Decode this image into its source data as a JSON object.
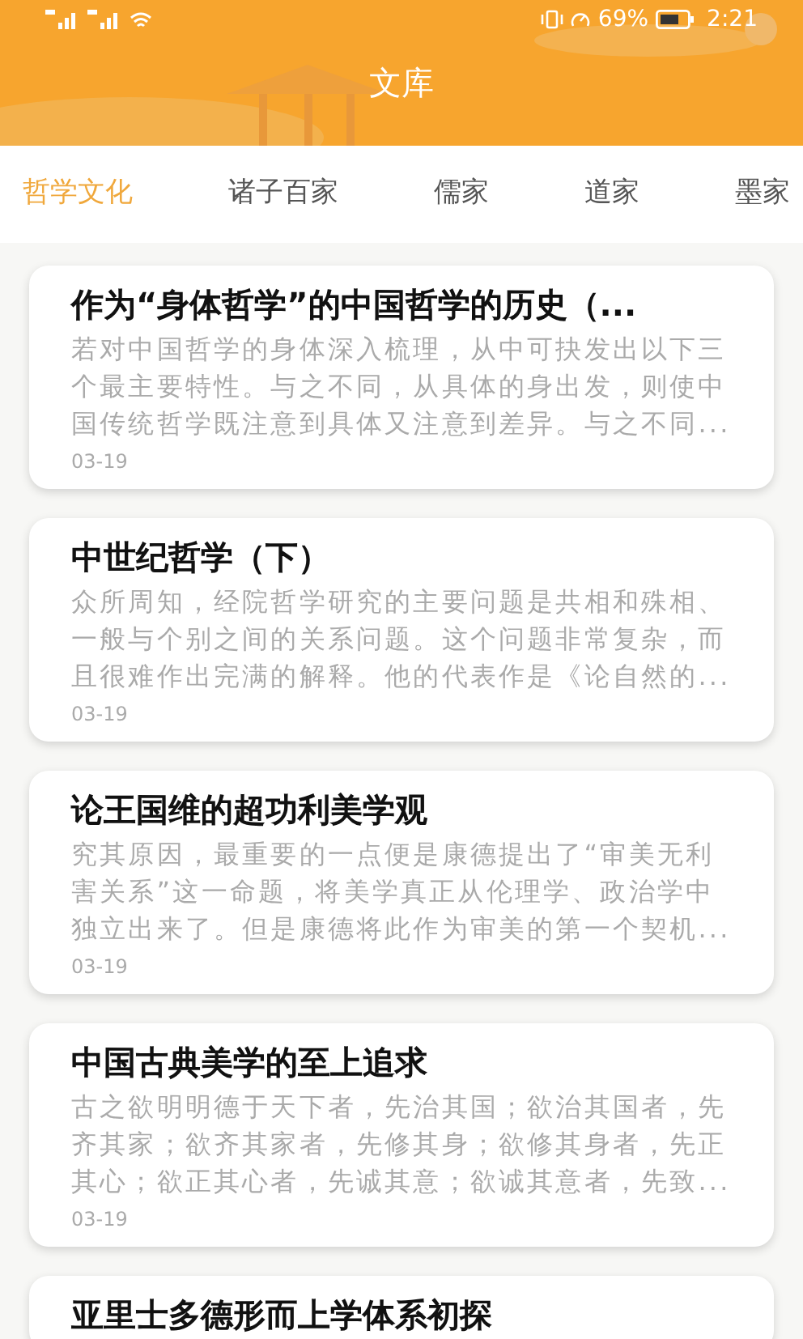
{
  "status_bar": {
    "battery": "69%",
    "time": "2:21"
  },
  "header": {
    "title": "文库"
  },
  "tabs": [
    {
      "label": "哲学文化",
      "selected": true
    },
    {
      "label": "诸子百家",
      "selected": false
    },
    {
      "label": "儒家",
      "selected": false
    },
    {
      "label": "道家",
      "selected": false
    },
    {
      "label": "墨家",
      "selected": false
    }
  ],
  "articles": [
    {
      "title": "作为“身体哲学”的中国哲学的历史（...",
      "summary": "若对中国哲学的身体深入梳理，从中可抉发出以下三个最主要特性。与之不同，从具体的身出发，则使中国传统哲学既注意到具体又注意到差异。与之不同...",
      "date": "03-19"
    },
    {
      "title": "中世纪哲学（下）",
      "summary": "众所周知，经院哲学研究的主要问题是共相和殊相、一般与个别之间的关系问题。这个问题非常复杂，而且很难作出完满的解释。他的代表作是《论自然的...",
      "date": "03-19"
    },
    {
      "title": "论王国维的超功利美学观",
      "summary": "究其原因，最重要的一点便是康德提出了“审美无利害关系”这一命题，将美学真正从伦理学、政治学中独立出来了。但是康德将此作为审美的第一个契机...",
      "date": "03-19"
    },
    {
      "title": "中国古典美学的至上追求",
      "summary": "古之欲明明德于天下者，先治其国；欲治其国者，先齐其家；欲齐其家者，先修其身；欲修其身者，先正其心；欲正其心者，先诚其意；欲诚其意者，先致...",
      "date": "03-19"
    },
    {
      "title": "亚里士多德形而上学体系初探"
    }
  ]
}
